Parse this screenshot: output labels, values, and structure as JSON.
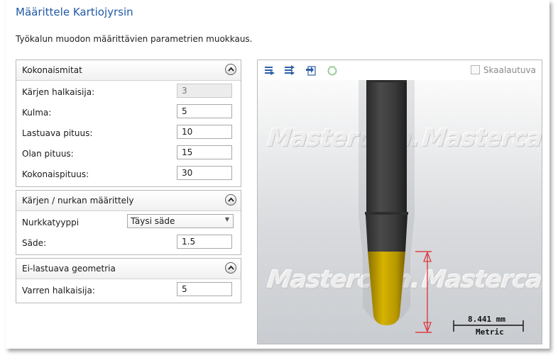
{
  "window": {
    "title": "Määrittele Kartiojyrsin",
    "subtitle": "Työkalun muodon määrittävien parametrien muokkaus."
  },
  "groups": {
    "overall": {
      "title": "Kokonaismitat",
      "fields": [
        {
          "label": "Kärjen halkaisija:",
          "value": "3",
          "disabled": true
        },
        {
          "label": "Kulma:",
          "value": "5"
        },
        {
          "label": "Lastuava pituus:",
          "value": "10"
        },
        {
          "label": "Olan pituus:",
          "value": "15"
        },
        {
          "label": "Kokonaispituus:",
          "value": "30"
        }
      ]
    },
    "tip": {
      "title": "Kärjen / nurkan määrittely",
      "corner_type_label": "Nurkkatyyppi",
      "corner_type_value": "Täysi säde",
      "radius_label": "Säde:",
      "radius_value": "1.5"
    },
    "noncutting": {
      "title": "Ei-lastuava geometria",
      "shank_label": "Varren halkaisija:",
      "shank_value": "5"
    }
  },
  "viewer": {
    "scalable_label": "Skaalautuva",
    "scalable_checked": false,
    "watermark": "Mastercam.",
    "scale_value": "8.441 mm",
    "scale_unit": "Metric",
    "colors": {
      "shank": "#3c3c3c",
      "flute": "#c9a400",
      "dimension": "#e0202a"
    },
    "toolbar_icons": [
      "list-arrow-icon",
      "list-arrows-icon",
      "import-icon",
      "recycle-icon"
    ]
  }
}
